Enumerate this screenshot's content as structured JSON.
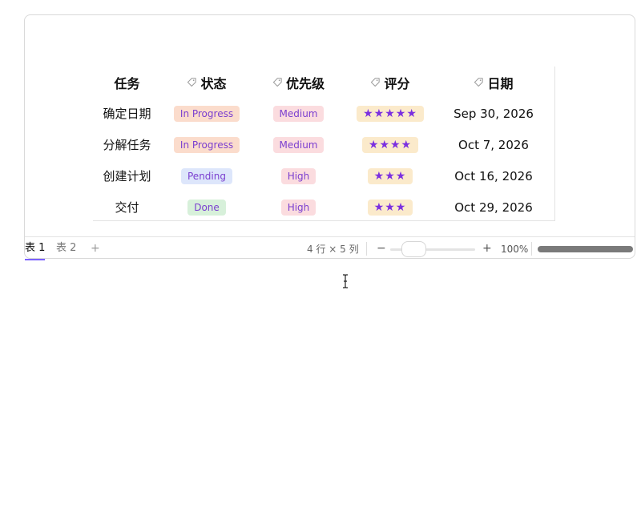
{
  "table": {
    "headers": [
      {
        "label": "任务",
        "icon": ""
      },
      {
        "label": "状态",
        "icon": "tag-icon"
      },
      {
        "label": "优先级",
        "icon": "tag-icon"
      },
      {
        "label": "评分",
        "icon": "tag-icon"
      },
      {
        "label": "日期",
        "icon": "tag-icon"
      }
    ],
    "rows": [
      {
        "task": "确定日期",
        "status": "In Progress",
        "priority": "Medium",
        "rating": "★★★★★",
        "date": "Sep 30, 2026"
      },
      {
        "task": "分解任务",
        "status": "In Progress",
        "priority": "Medium",
        "rating": "★★★★",
        "date": "Oct 7, 2026"
      },
      {
        "task": "创建计划",
        "status": "Pending",
        "priority": "High",
        "rating": "★★★",
        "date": "Oct 16, 2026"
      },
      {
        "task": "交付",
        "status": "Done",
        "priority": "High",
        "rating": "★★★",
        "date": "Oct 29, 2026"
      }
    ]
  },
  "footer": {
    "tabs": [
      {
        "label": "表 1",
        "active": true
      },
      {
        "label": "表 2",
        "active": false
      }
    ],
    "add_tab": "+",
    "dimensions": "4 行 × 5 列",
    "zoom_minus": "−",
    "zoom_plus": "+",
    "zoom_value": "100%",
    "zoom_level": 0.2
  },
  "colors": {
    "accent": "#7b2fe0",
    "status_in_progress_bg": "#fbdccc",
    "status_pending_bg": "#dde6fb",
    "status_done_bg": "#d7f0da",
    "priority_bg": "#fbdcdf",
    "rating_bg": "#fbeacb"
  }
}
